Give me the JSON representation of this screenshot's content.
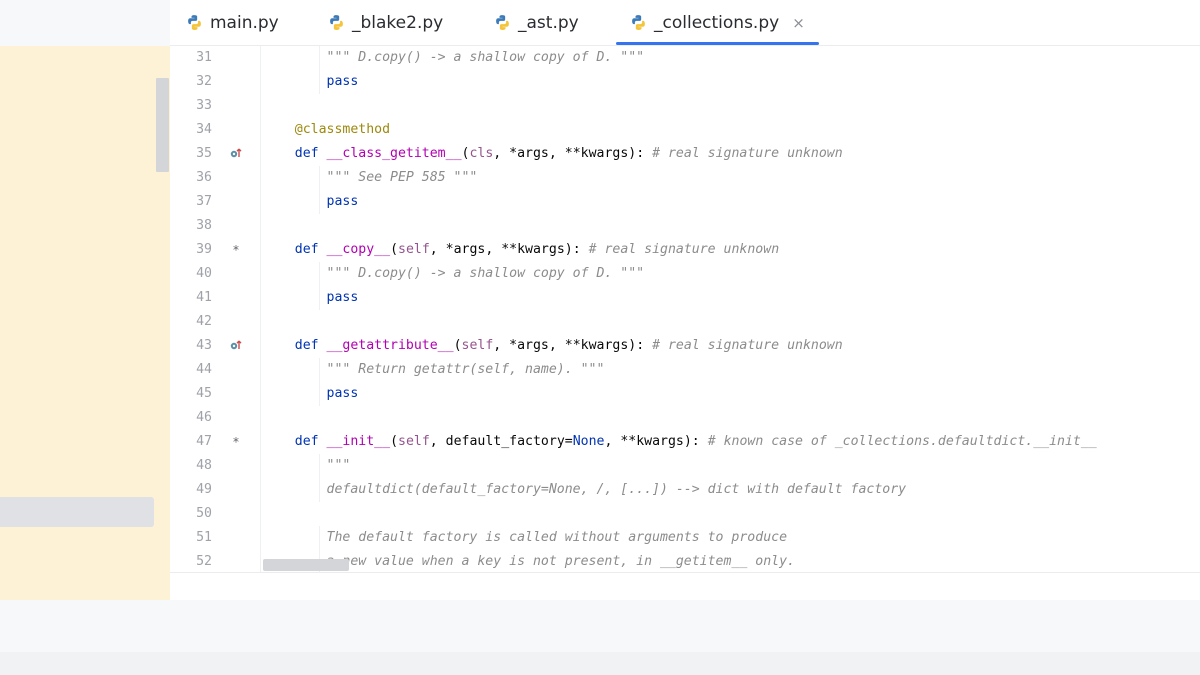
{
  "tabs": [
    {
      "label": "main.py",
      "active": false
    },
    {
      "label": "_blake2.py",
      "active": false
    },
    {
      "label": "_ast.py",
      "active": false
    },
    {
      "label": "_collections.py",
      "active": true,
      "close_glyph": "×"
    }
  ],
  "colors": {
    "accent": "#3574f0",
    "keyword": "#0033b3",
    "dunder": "#b200b2",
    "self": "#94558d",
    "comment": "#8c8c8c",
    "decorator": "#9e880d",
    "line_number": "#9fa2a9",
    "project_panel": "#fdf2d6"
  },
  "icons": {
    "file_type": "python-file-icon",
    "override_marker": "override-marker-icon",
    "implemented_marker": "asterisk-marker"
  },
  "editor": {
    "lines": [
      {
        "n": "31",
        "g": "",
        "parts": [
          [
            "cm",
            "        \"\"\" D.copy() -> a shallow copy of D. \"\"\""
          ]
        ]
      },
      {
        "n": "32",
        "g": "",
        "parts": [
          [
            "kw",
            "        pass"
          ]
        ]
      },
      {
        "n": "33",
        "g": "",
        "parts": []
      },
      {
        "n": "34",
        "g": "",
        "parts": [
          [
            "dec",
            "    @classmethod"
          ]
        ]
      },
      {
        "n": "35",
        "g": "o",
        "parts": [
          [
            "kw",
            "    def "
          ],
          [
            "dunder",
            "__class_getitem__"
          ],
          [
            "",
            "("
          ],
          [
            "self",
            "cls"
          ],
          [
            "",
            ", *args, **kwargs): "
          ],
          [
            "cm",
            "# real signature unknown"
          ]
        ]
      },
      {
        "n": "36",
        "g": "",
        "parts": [
          [
            "cm",
            "        \"\"\" See PEP 585 \"\"\""
          ]
        ]
      },
      {
        "n": "37",
        "g": "",
        "parts": [
          [
            "kw",
            "        pass"
          ]
        ]
      },
      {
        "n": "38",
        "g": "",
        "parts": []
      },
      {
        "n": "39",
        "g": "*",
        "parts": [
          [
            "kw",
            "    def "
          ],
          [
            "dunder",
            "__copy__"
          ],
          [
            "",
            "("
          ],
          [
            "self",
            "self"
          ],
          [
            "",
            ", *args, **kwargs): "
          ],
          [
            "cm",
            "# real signature unknown"
          ]
        ]
      },
      {
        "n": "40",
        "g": "",
        "parts": [
          [
            "cm",
            "        \"\"\" D.copy() -> a shallow copy of D. \"\"\""
          ]
        ]
      },
      {
        "n": "41",
        "g": "",
        "parts": [
          [
            "kw",
            "        pass"
          ]
        ]
      },
      {
        "n": "42",
        "g": "",
        "parts": []
      },
      {
        "n": "43",
        "g": "o",
        "parts": [
          [
            "kw",
            "    def "
          ],
          [
            "dunder",
            "__getattribute__"
          ],
          [
            "",
            "("
          ],
          [
            "self",
            "self"
          ],
          [
            "",
            ", *args, **kwargs): "
          ],
          [
            "cm",
            "# real signature unknown"
          ]
        ]
      },
      {
        "n": "44",
        "g": "",
        "parts": [
          [
            "cm",
            "        \"\"\" Return getattr(self, name). \"\"\""
          ]
        ]
      },
      {
        "n": "45",
        "g": "",
        "parts": [
          [
            "kw",
            "        pass"
          ]
        ]
      },
      {
        "n": "46",
        "g": "",
        "parts": []
      },
      {
        "n": "47",
        "g": "*",
        "parts": [
          [
            "kw",
            "    def "
          ],
          [
            "dunder",
            "__init__"
          ],
          [
            "",
            "("
          ],
          [
            "self",
            "self"
          ],
          [
            "",
            ", default_factory="
          ],
          [
            "nonekw",
            "None"
          ],
          [
            "",
            ", **kwargs): "
          ],
          [
            "cm",
            "# known case of _collections.defaultdict.__init__"
          ]
        ]
      },
      {
        "n": "48",
        "g": "",
        "parts": [
          [
            "cm",
            "        \"\"\""
          ]
        ]
      },
      {
        "n": "49",
        "g": "",
        "parts": [
          [
            "cm",
            "        defaultdict(default_factory=None, /, [...]) --> dict with default factory"
          ]
        ]
      },
      {
        "n": "50",
        "g": "",
        "parts": []
      },
      {
        "n": "51",
        "g": "",
        "parts": [
          [
            "cm",
            "        The default factory is called without arguments to produce"
          ]
        ]
      },
      {
        "n": "52",
        "g": "",
        "parts": [
          [
            "cm",
            "        a new value when a key is not present, in __getitem__ only."
          ]
        ]
      }
    ]
  }
}
